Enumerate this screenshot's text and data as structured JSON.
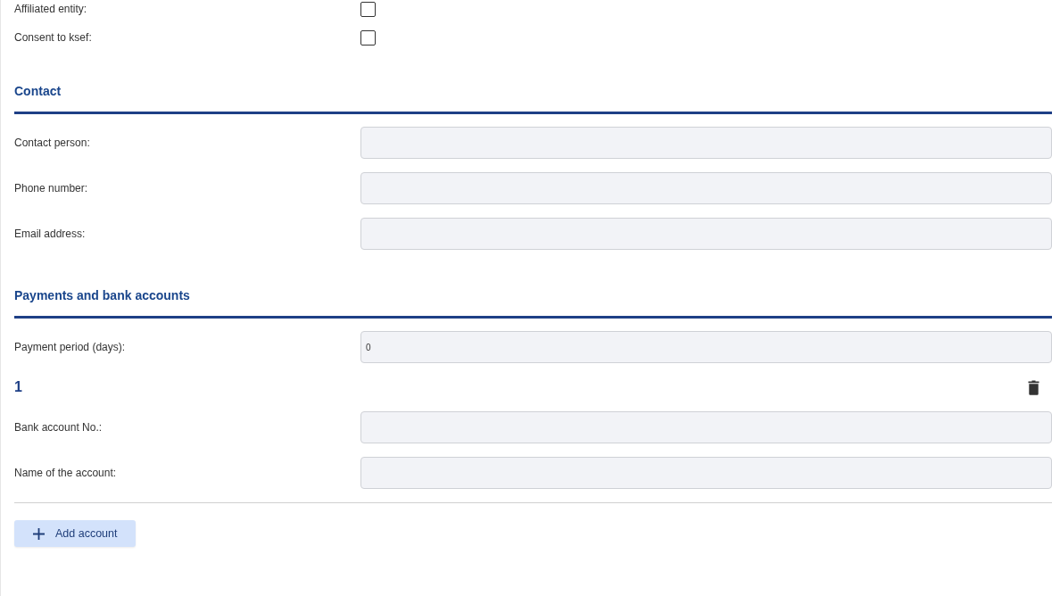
{
  "checkboxes": [
    {
      "label": "Affiliated entity:",
      "checked": false
    },
    {
      "label": "Consent to ksef:",
      "checked": false
    }
  ],
  "sections": [
    {
      "title": "Contact",
      "fields": [
        {
          "label": "Contact person:"
        },
        {
          "label": "Phone number:"
        },
        {
          "label": "Email address:"
        }
      ]
    },
    {
      "title": "Payments and bank accounts",
      "fields": [
        {
          "label": "Payment period (days):",
          "value": "0"
        }
      ],
      "accounts": [
        {
          "number": "1",
          "fields": [
            {
              "label": "Bank account No.:"
            },
            {
              "label": "Name of the account:"
            }
          ]
        }
      ],
      "add_button": "Add account"
    }
  ]
}
